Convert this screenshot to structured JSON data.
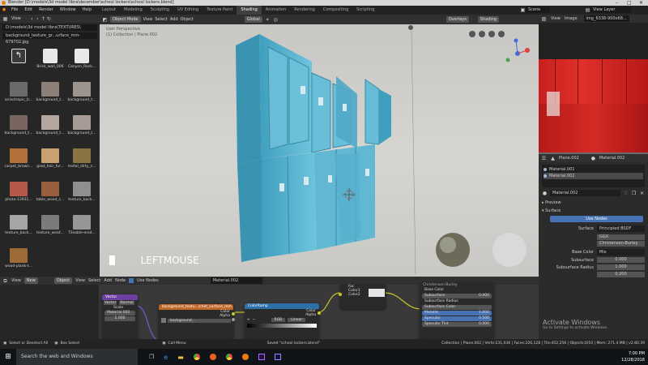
{
  "window": {
    "title": "Blender [D:\\models\\3d model libra\\december\\school lockers\\school lockers.blend]"
  },
  "menu": [
    "File",
    "Edit",
    "Render",
    "Window",
    "Help"
  ],
  "workspaces": [
    "Layout",
    "Modeling",
    "Sculpting",
    "UV Editing",
    "Texture Paint",
    "Shading",
    "Animation",
    "Rendering",
    "Compositing",
    "Scripting"
  ],
  "workspace_active": "Shading",
  "scene": {
    "scene_label": "Scene",
    "view_layer_label": "View Layer"
  },
  "file_browser": {
    "view_label": "View",
    "path": "D:\\models\\3d model libra\\TEXTURES\\",
    "filename": "background_texture_gr...urface_mm-679702.jpg",
    "items": [
      {
        "label": "",
        "kind": "parent"
      },
      {
        "label": "Brick_wall_006",
        "kind": "folder"
      },
      {
        "label": "Canyon_Rock...",
        "kind": "folder"
      },
      {
        "label": "anisotropic_b...",
        "color": "#6a6a6a"
      },
      {
        "label": "background_t...",
        "color": "#8b7f78"
      },
      {
        "label": "background_t...",
        "color": "#9c948e"
      },
      {
        "label": "background_t...",
        "color": "#7a6660"
      },
      {
        "label": "background_t...",
        "color": "#b3a79f"
      },
      {
        "label": "background_t...",
        "color": "#a89a95"
      },
      {
        "label": "carpet_brown...",
        "color": "#b5713a"
      },
      {
        "label": "goat_hair_fur...",
        "color": "#c9a070"
      },
      {
        "label": "metal_dirty_s...",
        "color": "#8a7444"
      },
      {
        "label": "photo-13931...",
        "color": "#b35a4a"
      },
      {
        "label": "table_wood_c...",
        "color": "#9a5f3d"
      },
      {
        "label": "texture_back...",
        "color": "#8f8f8f"
      },
      {
        "label": "texture_back...",
        "color": "#a5a5a5"
      },
      {
        "label": "texture_weat...",
        "color": "#7b7b7b"
      },
      {
        "label": "Tileable-erod...",
        "color": "#969696"
      },
      {
        "label": "wood-plank-t...",
        "color": "#9d6a3a"
      }
    ]
  },
  "viewport": {
    "mode": "Object Mode",
    "header_items": [
      "View",
      "Select",
      "Add",
      "Object"
    ],
    "transform": "Global",
    "overlays": "Overlays",
    "shading": "Shading",
    "info_line1": "User Perspective",
    "info_line2": "(1) Collection | Plane.002",
    "key_overlay": "LEFTMOUSE",
    "colors": {
      "locker": "#5fb6d0",
      "locker_dark": "#3a8aa6",
      "floor": "#cfcecb"
    }
  },
  "image_editor": {
    "header": [
      "View",
      "Image"
    ],
    "image_name": "img_6338-900x68..."
  },
  "properties": {
    "object": "Plane.002",
    "material": "Material.002",
    "slots": [
      "Material.001",
      "Material.002"
    ],
    "material_field": "Material.002",
    "sections": [
      "Preview",
      "Surface"
    ],
    "use_nodes": "Use Nodes",
    "surface_label": "Surface",
    "surface_value": "Principled BSDF",
    "distribution": "GGX",
    "subsurface_method": "Christensen-Burley",
    "base_color_label": "Base Color",
    "base_color_value": "Mix",
    "subsurface_label": "Subsurface",
    "subsurface_value": "0.000",
    "subsurface_radius_label": "Subsurface Radius",
    "subsurface_radius_value": "1.000",
    "subsurface_radius_value2": "0.200"
  },
  "node_editor": {
    "header": [
      "View",
      "Select",
      "Add",
      "Node"
    ],
    "new_button": "New",
    "use_nodes": "Use Nodes",
    "object": "Object",
    "material": "Material.002",
    "mapping_node": {
      "title": "Vector",
      "items": [
        "Vector",
        "Normal",
        "Scale",
        "Material.002"
      ],
      "value": "1.000"
    },
    "image_node": {
      "title": "background_textu...ichet_surface_mm",
      "image": "background...",
      "out1": "Color",
      "out2": "Alpha"
    },
    "colorramp_node": {
      "title": "ColorRamp",
      "out1": "Color",
      "out2": "Alpha",
      "interp": "RGB",
      "mode": "Linear"
    },
    "mix_node": {
      "fac": "Fac",
      "color1": "Color1",
      "color2": "Color2"
    },
    "bsdf_node": {
      "title": "Christensen-Burley",
      "rows": [
        {
          "label": "Base Color",
          "value": ""
        },
        {
          "label": "Subsurface:",
          "value": "0.000"
        },
        {
          "label": "Subsurface Radius",
          "value": ""
        },
        {
          "label": "Subsurface Color",
          "value": ""
        },
        {
          "label": "Metallic",
          "value": "1.000"
        },
        {
          "label": "Specular",
          "value": "0.500"
        },
        {
          "label": "Specular Tint",
          "value": "0.000"
        }
      ]
    }
  },
  "status": {
    "left1": "Select or Deselect All",
    "left2": "Box Select",
    "center1": "Call Menu",
    "saved": "Saved \"school lockers.blend\"",
    "stats": "Collection | Plane.002 | Verts:231,036 | Faces:226,128 | Tris:452,256 | Objects:0/10 | Mem: 271.4 MB | v2.80.39",
    "watermark1": "Activate Windows",
    "watermark2": "Go to Settings to activate Windows."
  },
  "taskbar": {
    "search": "Search the web and Windows",
    "time": "7:00 PM",
    "date": "12/28/2018"
  }
}
